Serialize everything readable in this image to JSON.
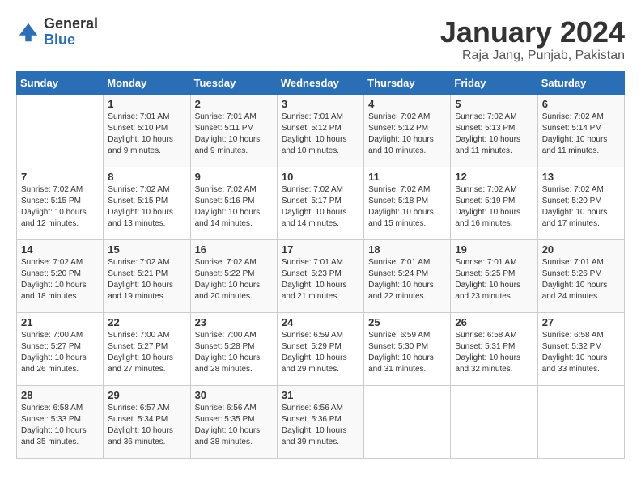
{
  "header": {
    "logo_general": "General",
    "logo_blue": "Blue",
    "title": "January 2024",
    "subtitle": "Raja Jang, Punjab, Pakistan"
  },
  "days_of_week": [
    "Sunday",
    "Monday",
    "Tuesday",
    "Wednesday",
    "Thursday",
    "Friday",
    "Saturday"
  ],
  "weeks": [
    [
      {
        "day": "",
        "info": ""
      },
      {
        "day": "1",
        "info": "Sunrise: 7:01 AM\nSunset: 5:10 PM\nDaylight: 10 hours\nand 9 minutes."
      },
      {
        "day": "2",
        "info": "Sunrise: 7:01 AM\nSunset: 5:11 PM\nDaylight: 10 hours\nand 9 minutes."
      },
      {
        "day": "3",
        "info": "Sunrise: 7:01 AM\nSunset: 5:12 PM\nDaylight: 10 hours\nand 10 minutes."
      },
      {
        "day": "4",
        "info": "Sunrise: 7:02 AM\nSunset: 5:12 PM\nDaylight: 10 hours\nand 10 minutes."
      },
      {
        "day": "5",
        "info": "Sunrise: 7:02 AM\nSunset: 5:13 PM\nDaylight: 10 hours\nand 11 minutes."
      },
      {
        "day": "6",
        "info": "Sunrise: 7:02 AM\nSunset: 5:14 PM\nDaylight: 10 hours\nand 11 minutes."
      }
    ],
    [
      {
        "day": "7",
        "info": "Sunrise: 7:02 AM\nSunset: 5:15 PM\nDaylight: 10 hours\nand 12 minutes."
      },
      {
        "day": "8",
        "info": "Sunrise: 7:02 AM\nSunset: 5:15 PM\nDaylight: 10 hours\nand 13 minutes."
      },
      {
        "day": "9",
        "info": "Sunrise: 7:02 AM\nSunset: 5:16 PM\nDaylight: 10 hours\nand 14 minutes."
      },
      {
        "day": "10",
        "info": "Sunrise: 7:02 AM\nSunset: 5:17 PM\nDaylight: 10 hours\nand 14 minutes."
      },
      {
        "day": "11",
        "info": "Sunrise: 7:02 AM\nSunset: 5:18 PM\nDaylight: 10 hours\nand 15 minutes."
      },
      {
        "day": "12",
        "info": "Sunrise: 7:02 AM\nSunset: 5:19 PM\nDaylight: 10 hours\nand 16 minutes."
      },
      {
        "day": "13",
        "info": "Sunrise: 7:02 AM\nSunset: 5:20 PM\nDaylight: 10 hours\nand 17 minutes."
      }
    ],
    [
      {
        "day": "14",
        "info": "Sunrise: 7:02 AM\nSunset: 5:20 PM\nDaylight: 10 hours\nand 18 minutes."
      },
      {
        "day": "15",
        "info": "Sunrise: 7:02 AM\nSunset: 5:21 PM\nDaylight: 10 hours\nand 19 minutes."
      },
      {
        "day": "16",
        "info": "Sunrise: 7:02 AM\nSunset: 5:22 PM\nDaylight: 10 hours\nand 20 minutes."
      },
      {
        "day": "17",
        "info": "Sunrise: 7:01 AM\nSunset: 5:23 PM\nDaylight: 10 hours\nand 21 minutes."
      },
      {
        "day": "18",
        "info": "Sunrise: 7:01 AM\nSunset: 5:24 PM\nDaylight: 10 hours\nand 22 minutes."
      },
      {
        "day": "19",
        "info": "Sunrise: 7:01 AM\nSunset: 5:25 PM\nDaylight: 10 hours\nand 23 minutes."
      },
      {
        "day": "20",
        "info": "Sunrise: 7:01 AM\nSunset: 5:26 PM\nDaylight: 10 hours\nand 24 minutes."
      }
    ],
    [
      {
        "day": "21",
        "info": "Sunrise: 7:00 AM\nSunset: 5:27 PM\nDaylight: 10 hours\nand 26 minutes."
      },
      {
        "day": "22",
        "info": "Sunrise: 7:00 AM\nSunset: 5:27 PM\nDaylight: 10 hours\nand 27 minutes."
      },
      {
        "day": "23",
        "info": "Sunrise: 7:00 AM\nSunset: 5:28 PM\nDaylight: 10 hours\nand 28 minutes."
      },
      {
        "day": "24",
        "info": "Sunrise: 6:59 AM\nSunset: 5:29 PM\nDaylight: 10 hours\nand 29 minutes."
      },
      {
        "day": "25",
        "info": "Sunrise: 6:59 AM\nSunset: 5:30 PM\nDaylight: 10 hours\nand 31 minutes."
      },
      {
        "day": "26",
        "info": "Sunrise: 6:58 AM\nSunset: 5:31 PM\nDaylight: 10 hours\nand 32 minutes."
      },
      {
        "day": "27",
        "info": "Sunrise: 6:58 AM\nSunset: 5:32 PM\nDaylight: 10 hours\nand 33 minutes."
      }
    ],
    [
      {
        "day": "28",
        "info": "Sunrise: 6:58 AM\nSunset: 5:33 PM\nDaylight: 10 hours\nand 35 minutes."
      },
      {
        "day": "29",
        "info": "Sunrise: 6:57 AM\nSunset: 5:34 PM\nDaylight: 10 hours\nand 36 minutes."
      },
      {
        "day": "30",
        "info": "Sunrise: 6:56 AM\nSunset: 5:35 PM\nDaylight: 10 hours\nand 38 minutes."
      },
      {
        "day": "31",
        "info": "Sunrise: 6:56 AM\nSunset: 5:36 PM\nDaylight: 10 hours\nand 39 minutes."
      },
      {
        "day": "",
        "info": ""
      },
      {
        "day": "",
        "info": ""
      },
      {
        "day": "",
        "info": ""
      }
    ]
  ]
}
